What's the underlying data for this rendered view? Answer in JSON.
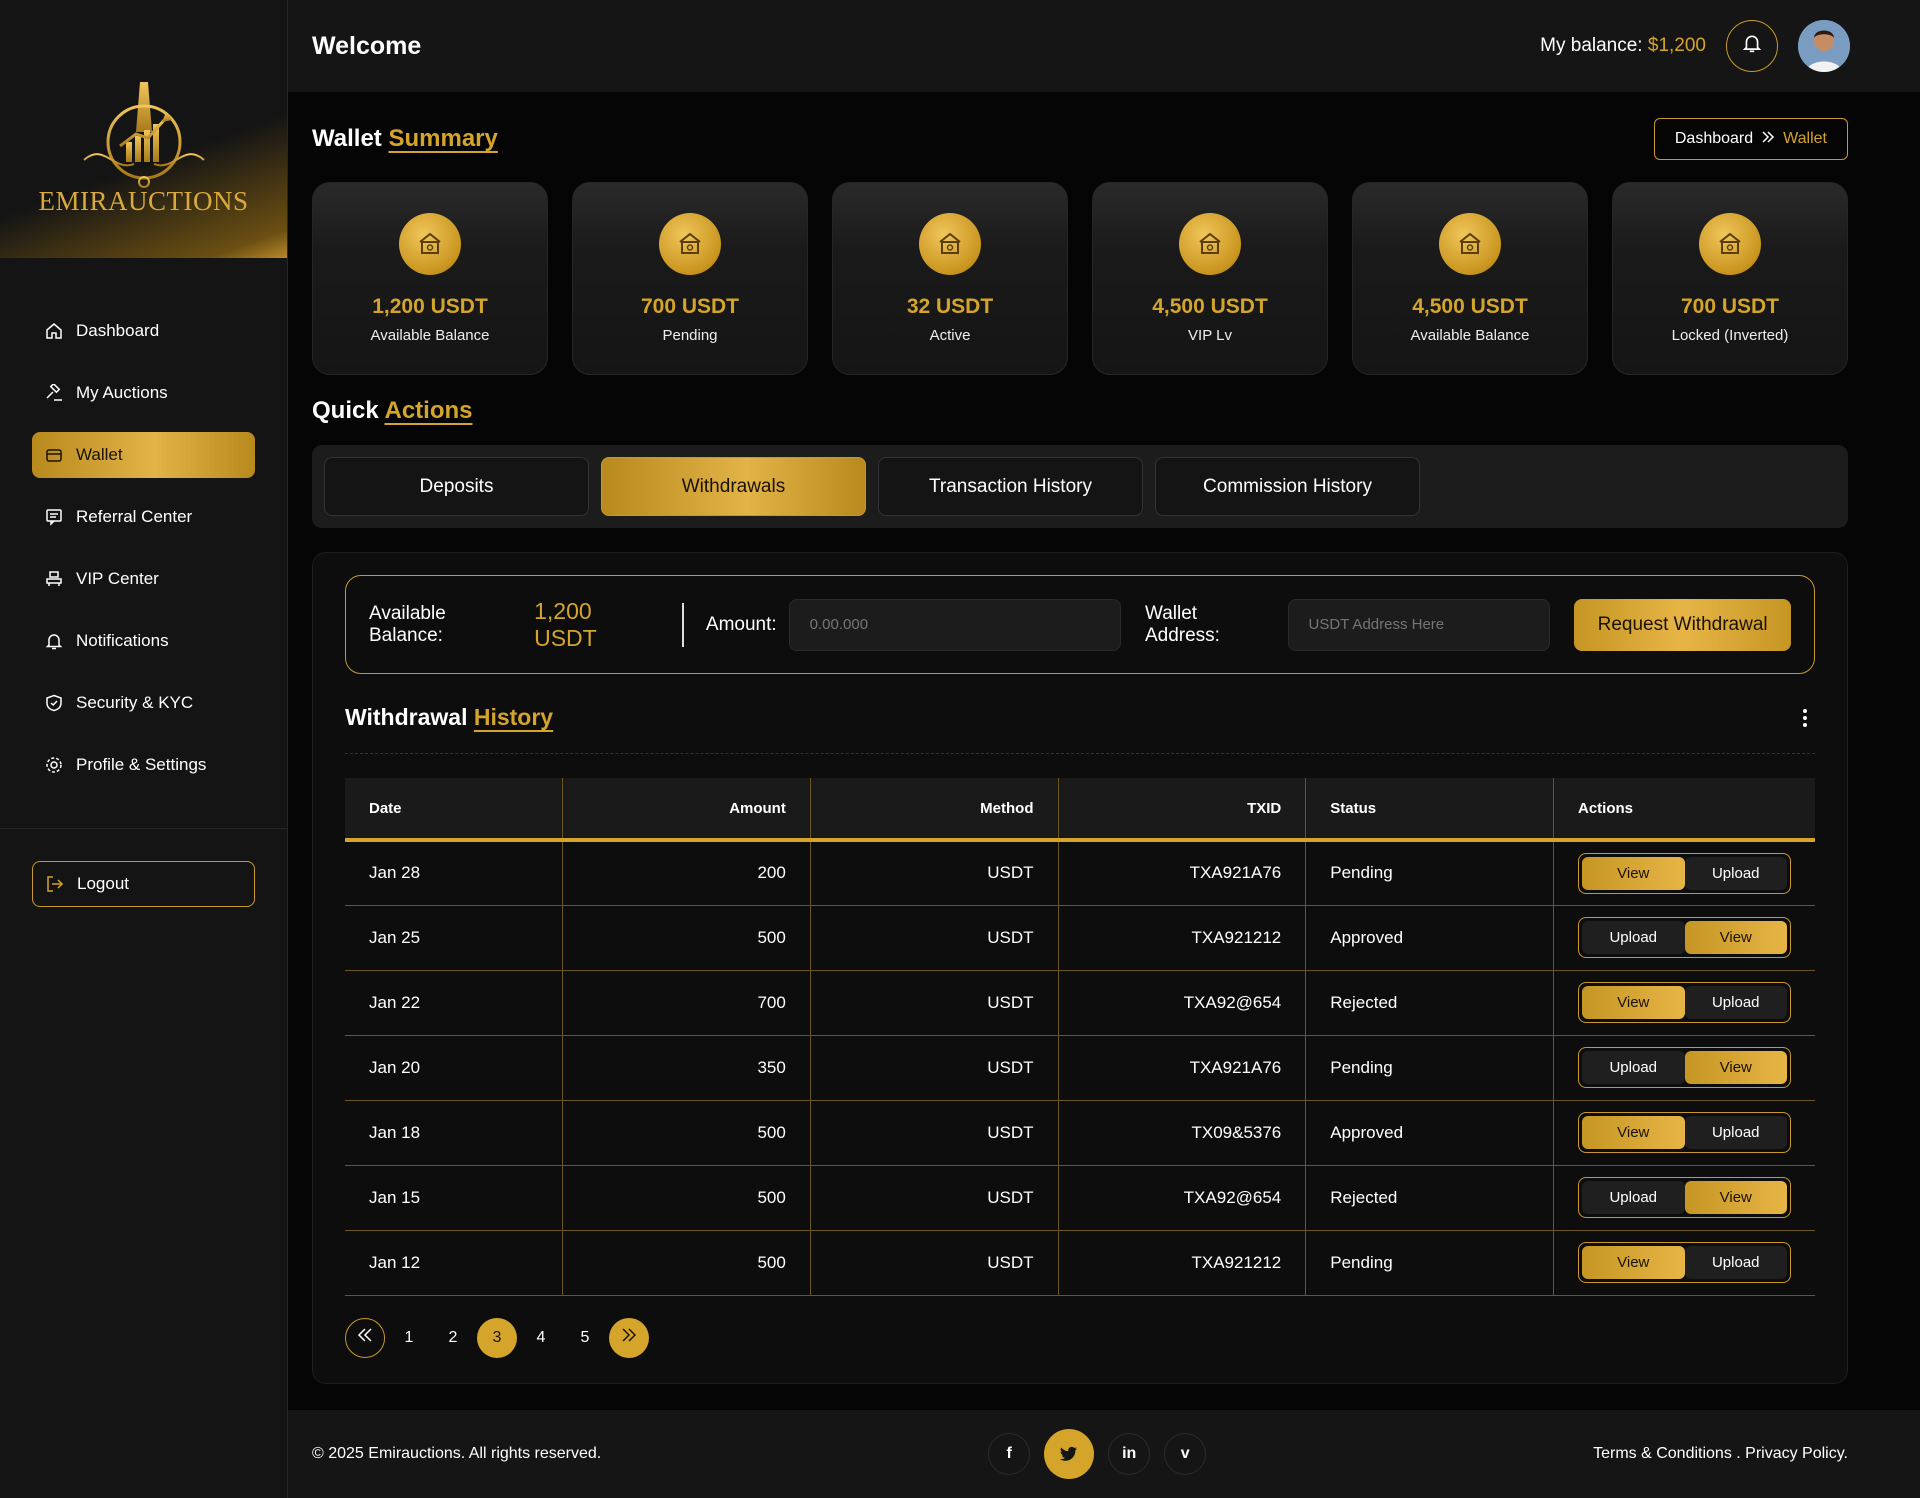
{
  "brand": {
    "name": "EMIRAUCTIONS",
    "accent": "#d4a52a"
  },
  "sidebar": {
    "items": [
      {
        "label": "Dashboard",
        "icon": "home-icon"
      },
      {
        "label": "My Auctions",
        "icon": "gavel-icon"
      },
      {
        "label": "Wallet",
        "icon": "wallet-icon",
        "active": true
      },
      {
        "label": "Referral Center",
        "icon": "referral-icon"
      },
      {
        "label": "VIP Center",
        "icon": "vip-icon"
      },
      {
        "label": "Notifications",
        "icon": "bell-icon"
      },
      {
        "label": "Security & KYC",
        "icon": "shield-icon"
      },
      {
        "label": "Profile & Settings",
        "icon": "gear-icon"
      }
    ],
    "logout": "Logout"
  },
  "header": {
    "title": "Welcome",
    "balance_label": "My balance:",
    "balance_value": "$1,200"
  },
  "summary": {
    "title": "Wallet",
    "title_accent": "Summary",
    "breadcrumb": [
      "Dashboard",
      "Wallet"
    ],
    "cards": [
      {
        "value": "1,200 USDT",
        "label": "Available Balance"
      },
      {
        "value": "700 USDT",
        "label": "Pending"
      },
      {
        "value": "32 USDT",
        "label": "Active"
      },
      {
        "value": "4,500 USDT",
        "label": "VIP Lv"
      },
      {
        "value": "4,500 USDT",
        "label": "Available Balance"
      },
      {
        "value": "700 USDT",
        "label": "Locked (Inverted)"
      }
    ]
  },
  "quick": {
    "title": "Quick",
    "title_accent": "Actions",
    "tabs": [
      "Deposits",
      "Withdrawals",
      "Transaction History",
      "Commission History"
    ],
    "active_tab": 1
  },
  "form": {
    "available_label": "Available Balance:",
    "available_value": "1,200 USDT",
    "amount_label": "Amount:",
    "amount_placeholder": "0.00.000",
    "wallet_label": "Wallet Address:",
    "wallet_placeholder": "USDT Address Here",
    "submit": "Request Withdrawal"
  },
  "history": {
    "title": "Withdrawal",
    "title_accent": "History",
    "columns": [
      "Date",
      "Amount",
      "Method",
      "TXID",
      "Status",
      "Actions"
    ],
    "rows": [
      {
        "date": "Jan 28",
        "amount": "200",
        "method": "USDT",
        "txid": "TXA921A76",
        "status": "Pending",
        "actions": [
          "View",
          "Upload"
        ],
        "hl": 0
      },
      {
        "date": "Jan 25",
        "amount": "500",
        "method": "USDT",
        "txid": "TXA921212",
        "status": "Approved",
        "actions": [
          "Upload",
          "View"
        ],
        "hl": 1
      },
      {
        "date": "Jan 22",
        "amount": "700",
        "method": "USDT",
        "txid": "TXA92@654",
        "status": "Rejected",
        "actions": [
          "View",
          "Upload"
        ],
        "hl": 0
      },
      {
        "date": "Jan 20",
        "amount": "350",
        "method": "USDT",
        "txid": "TXA921A76",
        "status": "Pending",
        "actions": [
          "Upload",
          "View"
        ],
        "hl": 1
      },
      {
        "date": "Jan 18",
        "amount": "500",
        "method": "USDT",
        "txid": "TX09&5376",
        "status": "Approved",
        "actions": [
          "View",
          "Upload"
        ],
        "hl": 0
      },
      {
        "date": "Jan 15",
        "amount": "500",
        "method": "USDT",
        "txid": "TXA92@654",
        "status": "Rejected",
        "actions": [
          "Upload",
          "View"
        ],
        "hl": 1
      },
      {
        "date": "Jan 12",
        "amount": "500",
        "method": "USDT",
        "txid": "TXA921212",
        "status": "Pending",
        "actions": [
          "View",
          "Upload"
        ],
        "hl": 0
      }
    ]
  },
  "pagination": {
    "pages": [
      "1",
      "2",
      "3",
      "4",
      "5"
    ],
    "current": "3"
  },
  "footer": {
    "copyright": "© 2025 Emirauctions. All rights reserved.",
    "social": [
      "f",
      "t",
      "in",
      "v"
    ],
    "links": "Terms & Conditions . Privacy Policy."
  }
}
